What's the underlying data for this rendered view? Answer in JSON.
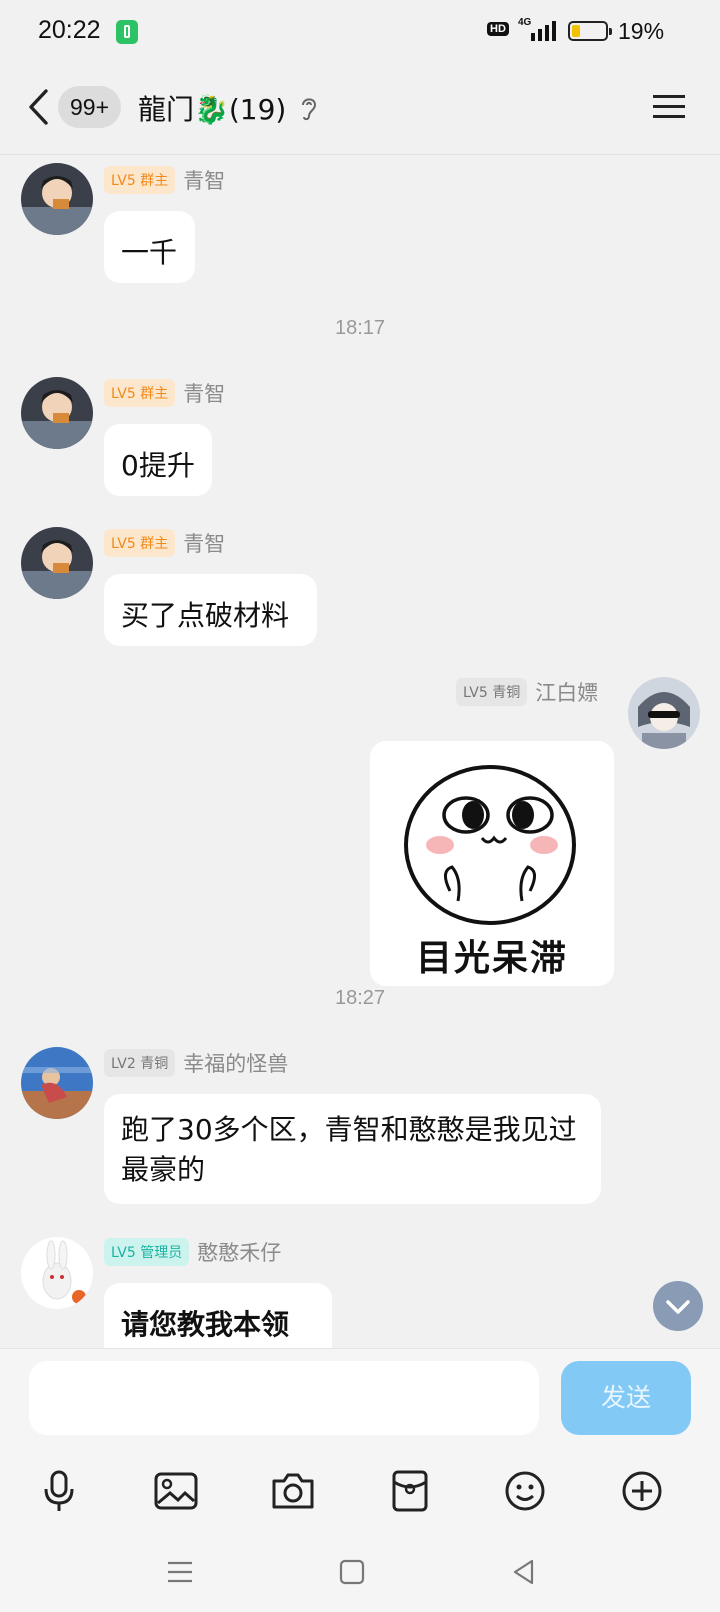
{
  "status_bar": {
    "time": "20:22",
    "hd_label": "HD",
    "network_label": "4G",
    "battery_percent": "19%",
    "battery_level": 0.19
  },
  "header": {
    "unread_badge": "99+",
    "group_title": "龍门🐉(19)"
  },
  "messages": [
    {
      "level": "LV5",
      "role": "群主",
      "sender": "青智",
      "text": "一千"
    },
    {
      "level": "LV5",
      "role": "群主",
      "sender": "青智",
      "text": "0提升"
    },
    {
      "level": "LV5",
      "role": "群主",
      "sender": "青智",
      "text": "买了点破材料"
    },
    {
      "level": "LV5",
      "role": "青铜",
      "sender": "江白嫖",
      "sticker_text": "目光呆滞"
    },
    {
      "level": "LV2",
      "role": "青铜",
      "sender": "幸福的怪兽",
      "text": "跑了30多个区，青智和憨憨是我见过最豪的"
    },
    {
      "level": "LV5",
      "role": "管理员",
      "sender": "憨憨禾仔",
      "text": "请您教我本领"
    }
  ],
  "timestamps": [
    "18:17",
    "18:27"
  ],
  "input": {
    "placeholder": "",
    "send_label": "发送"
  },
  "toolbar": {
    "icons": [
      "microphone-icon",
      "image-icon",
      "camera-icon",
      "red-packet-icon",
      "emoji-icon",
      "plus-icon"
    ]
  },
  "colors": {
    "owner_badge": "#f08a1a",
    "admin_badge": "#19b3a1",
    "send_button": "#82c9f5",
    "battery": "#f2c200"
  }
}
